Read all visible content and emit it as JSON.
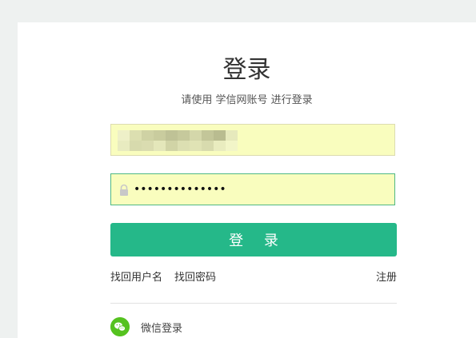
{
  "page": {
    "title": "登录",
    "subtitle": "请使用 学信网账号 进行登录"
  },
  "form": {
    "username_value": "",
    "password_mask": "••••••••••••••",
    "login_label": "登 录"
  },
  "links": {
    "find_username": "找回用户名",
    "find_password": "找回密码",
    "register": "注册"
  },
  "alt_login": {
    "wechat_label": "微信登录",
    "wechat_icon": "wechat-icon"
  },
  "colors": {
    "primary": "#25b889",
    "autofill_bg": "#f9fdbe",
    "wechat": "#55c21f",
    "page_bg": "#eef1f0"
  }
}
